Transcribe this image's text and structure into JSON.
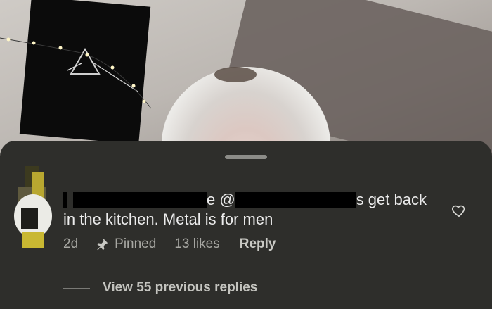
{
  "comment": {
    "username_redacted": "",
    "mention_prefix": "e @",
    "text_line1_end": "s get back",
    "text_line2": "in the kitchen. Metal is for men",
    "time": "2d",
    "pinned_label": "Pinned",
    "likes": "13 likes",
    "reply_label": "Reply"
  },
  "replies": {
    "view_label": "View 55 previous replies"
  },
  "icons": {
    "pin": "pin-icon",
    "like": "heart-icon"
  },
  "colors": {
    "sheet_background": "#2e2e2b",
    "primary_text": "#ececec",
    "secondary_text": "#a8a8a3"
  }
}
